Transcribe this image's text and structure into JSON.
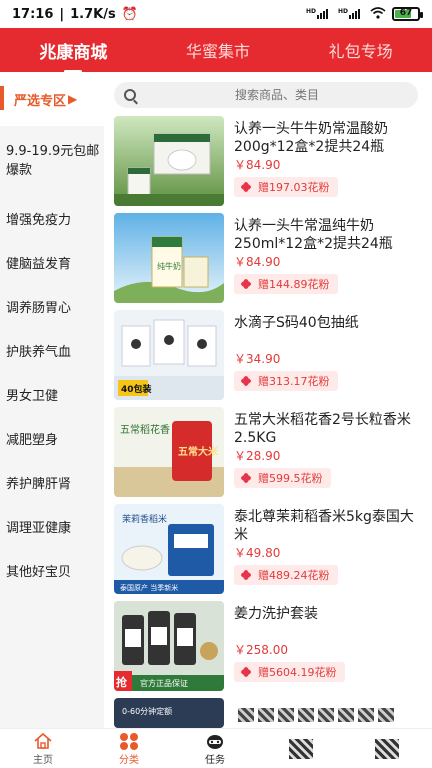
{
  "status": {
    "time": "17:16",
    "speed": "1.7K/s",
    "battery": "67",
    "network": "HD"
  },
  "header": {
    "tabs": [
      {
        "label": "兆康商城"
      },
      {
        "label": "华蜜集市"
      },
      {
        "label": "礼包专场"
      }
    ]
  },
  "sidebar": {
    "items": [
      {
        "label": "严选专区"
      },
      {
        "label": "9.9-19.9元包邮爆款"
      },
      {
        "label": "增强免疫力"
      },
      {
        "label": "健脑益发育"
      },
      {
        "label": "调养肠胃心"
      },
      {
        "label": "护肤养气血"
      },
      {
        "label": "男女卫健"
      },
      {
        "label": "减肥塑身"
      },
      {
        "label": "养护脾肝肾"
      },
      {
        "label": "调理亚健康"
      },
      {
        "label": "其他好宝贝"
      }
    ]
  },
  "search": {
    "placeholder": "搜索商品、类目"
  },
  "products": [
    {
      "name": "认养一头牛牛奶常温酸奶200g*12盒*2提共24瓶",
      "price": "￥84.90",
      "points": "赠197.03花粉"
    },
    {
      "name": "认养一头牛常温纯牛奶250ml*12盒*2提共24瓶",
      "price": "￥84.90",
      "points": "赠144.89花粉"
    },
    {
      "name": "水滴子S码40包抽纸",
      "price": "￥34.90",
      "points": "赠313.17花粉"
    },
    {
      "name": "五常大米稻花香2号长粒香米2.5KG",
      "price": "￥28.90",
      "points": "赠599.5花粉"
    },
    {
      "name": "泰北尊茉莉稻香米5kg泰国大米",
      "price": "￥49.80",
      "points": "赠489.24花粉"
    },
    {
      "name": "姜力洗护套装",
      "price": "￥258.00",
      "points": "赠5604.19花粉"
    }
  ],
  "thumb_text": {
    "p2": "纯牛奶",
    "p3": "40包装",
    "p4_top": "五常稻花香",
    "p4_bag": "五常大米",
    "p5_top": "茉莉香稻米",
    "p5_bottom": "泰国原产 当季新米",
    "p6_badge": "抢",
    "p6_banner": "官方正品保证",
    "p7": "0-60分钟定额"
  },
  "bottom_nav": [
    {
      "label": "主页"
    },
    {
      "label": "分类"
    },
    {
      "label": "任务"
    }
  ],
  "colors": {
    "brand_red": "#e52b2f",
    "accent_orange": "#e85a2a",
    "price_red": "#e23a3a"
  }
}
